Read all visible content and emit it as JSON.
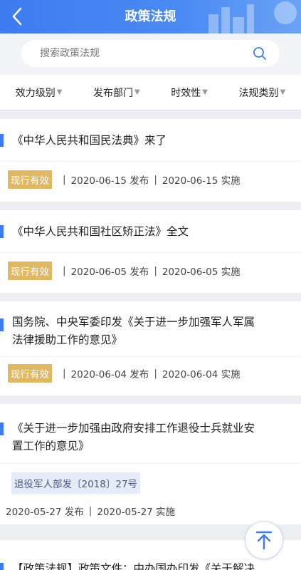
{
  "header": {
    "title": "政策法规"
  },
  "search": {
    "placeholder": "搜索政策法规"
  },
  "filters": [
    {
      "label": "效力级别"
    },
    {
      "label": "发布部门"
    },
    {
      "label": "时效性"
    },
    {
      "label": "法规类别"
    }
  ],
  "items": [
    {
      "title": "《中华人民共和国民法典》来了",
      "status": "现行有效",
      "publish": "2020-06-15 发布",
      "effective": "2020-06-15 实施"
    },
    {
      "title": "《中华人民共和国社区矫正法》全文",
      "status": "现行有效",
      "publish": "2020-06-05 发布",
      "effective": "2020-06-05 实施"
    },
    {
      "title_line1": "国务院、中央军委印发《关于进一步加强军人军属",
      "title_line2": "法律援助工作的意见》",
      "status": "现行有效",
      "publish": "2020-06-04 发布",
      "effective": "2020-06-04 实施"
    },
    {
      "title_line1": "《关于进一步加强由政府安排工作退役士兵就业安",
      "title_line2": "置工作的意见》",
      "doc_number": "退役军人部发〔2018〕27号",
      "publish": "2020-05-27 发布",
      "effective": "2020-05-27 实施"
    },
    {
      "title": "【政策法规】政策文件：中办国办印发《关于解决"
    }
  ],
  "colors": {
    "brand": "#3d7cf0",
    "badge": "#e0b861",
    "background": "#eceef2"
  }
}
